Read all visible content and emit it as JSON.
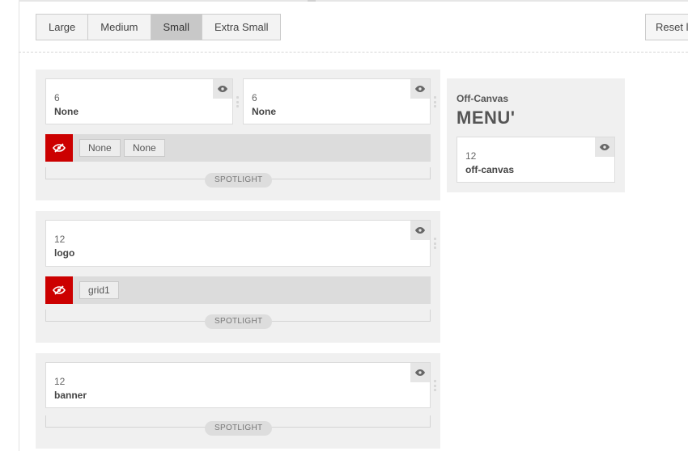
{
  "toolbar": {
    "tabs": [
      {
        "label": "Large",
        "active": false
      },
      {
        "label": "Medium",
        "active": false
      },
      {
        "label": "Small",
        "active": true
      },
      {
        "label": "Extra Small",
        "active": false
      }
    ],
    "reset_label": "Reset l"
  },
  "sections": {
    "top": {
      "blocks": [
        {
          "size": "6",
          "name": "None"
        },
        {
          "size": "6",
          "name": "None"
        }
      ],
      "hidden_chips": [
        "None",
        "None"
      ],
      "spotlight_label": "SPOTLIGHT"
    },
    "logo": {
      "blocks": [
        {
          "size": "12",
          "name": "logo"
        }
      ],
      "hidden_chips": [
        "grid1"
      ],
      "spotlight_label": "SPOTLIGHT"
    },
    "banner": {
      "blocks": [
        {
          "size": "12",
          "name": "banner"
        }
      ],
      "spotlight_label": "SPOTLIGHT"
    }
  },
  "offcanvas": {
    "title": "Off-Canvas",
    "heading": "MENU'",
    "block": {
      "size": "12",
      "name": "off-canvas"
    }
  },
  "colors": {
    "hidden_red": "#cc0000",
    "section_bg": "#f0f0f0",
    "active_tab": "#c8c8c8"
  },
  "icons": {
    "visibility": "eye-icon",
    "hidden": "eye-slash-icon",
    "drag": "drag-handle-icon"
  }
}
